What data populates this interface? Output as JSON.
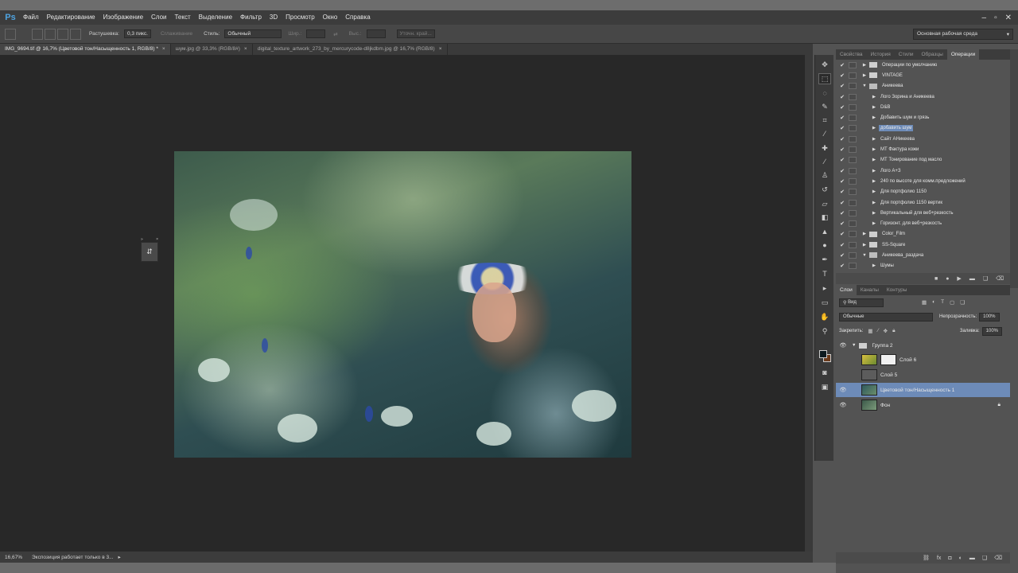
{
  "app": {
    "logo": "Ps"
  },
  "menu": [
    "Файл",
    "Редактирование",
    "Изображение",
    "Слои",
    "Текст",
    "Выделение",
    "Фильтр",
    "3D",
    "Просмотр",
    "Окно",
    "Справка"
  ],
  "window_controls": [
    "–",
    "▫",
    "✕"
  ],
  "options": {
    "feather_label": "Растушевка:",
    "feather_value": "0,3 пикс.",
    "antialias_label": "Сглаживание",
    "style_label": "Стиль:",
    "style_value": "Обычный",
    "width_label": "Шир.:",
    "height_label": "Выс.:",
    "refine_label": "Уточн. край...",
    "workspace": "Основная рабочая среда"
  },
  "doc_tabs": [
    {
      "label": "IMG_9694.tif @ 16,7% (Цветовой тон/Насыщенность 1, RGB/8) *",
      "active": true
    },
    {
      "label": "шум.jpg @ 33,3% (RGB/8#)",
      "active": false
    },
    {
      "label": "digital_texture_artwork_273_by_mercurycode-d8jkdbm.jpg @ 16,7% (RGB/8)",
      "active": false
    }
  ],
  "status": {
    "zoom": "16,67%",
    "message": "Экспозиция работает только в 3..."
  },
  "actions_panel": {
    "tabs": [
      "Свойства",
      "История",
      "Стили",
      "Образцы",
      "Операции"
    ],
    "active_tab": "Операции",
    "items": [
      {
        "name": "Операции по умолчанию",
        "type": "set",
        "expanded": false,
        "level": 0,
        "selected": false
      },
      {
        "name": "VINTAGE",
        "type": "set",
        "expanded": false,
        "level": 0,
        "selected": false
      },
      {
        "name": "Аникеева",
        "type": "set",
        "expanded": true,
        "level": 0,
        "selected": false
      },
      {
        "name": "Лого Зорина и Аникеева",
        "type": "action",
        "expanded": false,
        "level": 1,
        "selected": false
      },
      {
        "name": "D&B",
        "type": "action",
        "expanded": false,
        "level": 1,
        "selected": false
      },
      {
        "name": "Добавить шум и грязь",
        "type": "action",
        "expanded": false,
        "level": 1,
        "selected": false
      },
      {
        "name": "добавить шум",
        "type": "action",
        "expanded": false,
        "level": 1,
        "selected": true
      },
      {
        "name": "Сайт АНикеева",
        "type": "action",
        "expanded": false,
        "level": 1,
        "selected": false
      },
      {
        "name": "МТ Фактура кожи",
        "type": "action",
        "expanded": false,
        "level": 1,
        "selected": false
      },
      {
        "name": "МТ Тонирование под масло",
        "type": "action",
        "expanded": false,
        "level": 1,
        "selected": false
      },
      {
        "name": "Лого А+З",
        "type": "action",
        "expanded": false,
        "level": 1,
        "selected": false
      },
      {
        "name": "240 по высоте для комм.предложений",
        "type": "action",
        "expanded": false,
        "level": 1,
        "selected": false
      },
      {
        "name": "Для портфолио 1150",
        "type": "action",
        "expanded": false,
        "level": 1,
        "selected": false
      },
      {
        "name": "Для портфолио 1150 вертик",
        "type": "action",
        "expanded": false,
        "level": 1,
        "selected": false
      },
      {
        "name": "Вертикальный для веб+резкость",
        "type": "action",
        "expanded": false,
        "level": 1,
        "selected": false
      },
      {
        "name": "Горизонт. для веб+резкость",
        "type": "action",
        "expanded": false,
        "level": 1,
        "selected": false
      },
      {
        "name": "Color_Film",
        "type": "set",
        "expanded": false,
        "level": 0,
        "selected": false
      },
      {
        "name": "SS-Square",
        "type": "set",
        "expanded": false,
        "level": 0,
        "selected": false
      },
      {
        "name": "Аникеева_раздача",
        "type": "set",
        "expanded": true,
        "level": 0,
        "selected": false
      },
      {
        "name": "Шумы",
        "type": "action",
        "expanded": false,
        "level": 1,
        "selected": false
      }
    ],
    "footer_icons": [
      "stop-icon",
      "record-icon",
      "play-icon",
      "new-set-icon",
      "new-action-icon",
      "delete-icon"
    ]
  },
  "layers_panel": {
    "tabs": [
      "Слои",
      "Каналы",
      "Контуры"
    ],
    "active_tab": "Слои",
    "filter": "Вид",
    "blend_mode": "Обычные",
    "opacity_label": "Непрозрачность:",
    "opacity_value": "100%",
    "lock_label": "Закрепить:",
    "fill_label": "Заливка:",
    "fill_value": "100%",
    "layers": [
      {
        "name": "Группа 2",
        "kind": "group",
        "visible": true,
        "selected": false
      },
      {
        "name": "Слой 6",
        "kind": "layer-mask",
        "visible": false,
        "selected": false
      },
      {
        "name": "Слой 5",
        "kind": "layer",
        "visible": false,
        "selected": false
      },
      {
        "name": "Цветовой тон/Насыщенность 1",
        "kind": "adjustment",
        "visible": true,
        "selected": true
      },
      {
        "name": "Фон",
        "kind": "background",
        "visible": true,
        "selected": false,
        "locked": true
      }
    ]
  },
  "mini_panel": {
    "glyph": "⇵"
  },
  "colors": {
    "accent": "#6d8bb8",
    "bg_canvas": "#282828",
    "panel": "#535353"
  }
}
